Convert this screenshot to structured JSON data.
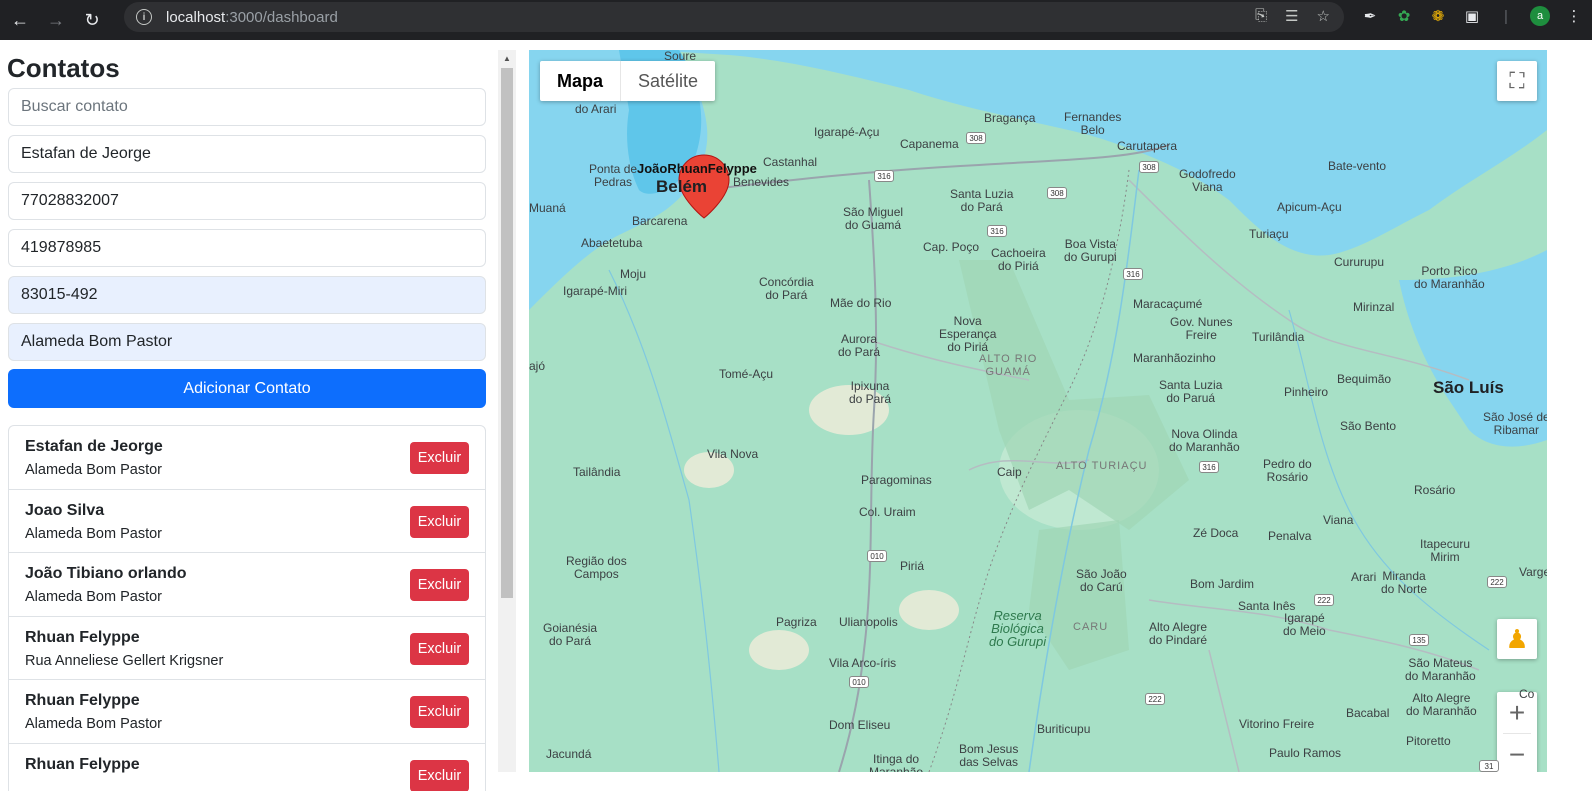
{
  "browser": {
    "url_host": "localhost",
    "url_path": ":3000/dashboard",
    "avatar_letter": "a"
  },
  "sidebar": {
    "title": "Contatos",
    "search_placeholder": "Buscar contato",
    "fields": {
      "name": "Estafan de Jeorge",
      "cpf": "77028832007",
      "phone": "419878985",
      "cep": "83015-492",
      "address": "Alameda Bom Pastor"
    },
    "add_button": "Adicionar Contato",
    "delete_label": "Excluir",
    "contacts": [
      {
        "name": "Estafan de Jeorge",
        "address": "Alameda Bom Pastor"
      },
      {
        "name": "Joao Silva",
        "address": "Alameda Bom Pastor"
      },
      {
        "name": "João Tibiano orlando",
        "address": "Alameda Bom Pastor"
      },
      {
        "name": "Rhuan Felyppe",
        "address": "Rua Anneliese Gellert Krigsner"
      },
      {
        "name": "Rhuan Felyppe",
        "address": "Alameda Bom Pastor"
      },
      {
        "name": "Rhuan Felyppe",
        "address": ""
      }
    ]
  },
  "map": {
    "type_map": "Mapa",
    "type_satellite": "Satélite",
    "marker_label": "JoãoRhuanFelyppe",
    "labels": {
      "soure": "Soure",
      "do_arari": "do Arari",
      "igarape_acu": "Igarapé-Açu",
      "braganca": "Bragança",
      "fernandes_belo": "Fernandes\nBelo",
      "capanema": "Capanema",
      "carutapera": "Carutapera",
      "ponta_de_pedras": "Ponta de\nPedras",
      "castanhal": "Castanhal",
      "benevides": "Benevides",
      "belem": "Belém",
      "bate_vento": "Bate-vento",
      "godofredo_viana": "Godofredo\nViana",
      "muana": "Muaná",
      "barcarena": "Barcarena",
      "santa_luzia_do_para": "Santa Luzia\ndo Pará",
      "sao_miguel_do_guama": "São Miguel\ndo Guamá",
      "apicum_acu": "Apicum-Açu",
      "abaetetuba": "Abaetetuba",
      "cap_poco": "Cap. Poço",
      "cachoeira_do_piria": "Cachoeira\ndo Piriá",
      "boa_vista_do_gurupi": "Boa Vista\ndo Gurupi",
      "turiacu": "Turiaçu",
      "moju": "Moju",
      "cururupu": "Cururupu",
      "igarape_miri": "Igarapé-Miri",
      "concordia_do_para": "Concórdia\ndo Pará",
      "porto_rico_do_maranhao": "Porto Rico\ndo Maranhão",
      "mae_do_rio": "Mãe do Rio",
      "maracacume": "Maracaçumé",
      "mirinzal": "Mirinzal",
      "nova_esperanca_do_piria": "Nova\nEsperança\ndo Piriá",
      "gov_nunes_freire": "Gov. Nunes\nFreire",
      "turilandia": "Turilândia",
      "aurora_do_para": "Aurora\ndo Pará",
      "alto_rio_guama": "ALTO RIO\nGUAMÁ",
      "maranhaozinho": "Maranhãozinho",
      "tome_acu": "Tomé-Açu",
      "bequimao": "Bequimão",
      "ipixuna_do_para": "Ipixuna\ndo Pará",
      "santa_luzia_do_parua": "Santa Luzia\ndo Paruá",
      "pinheiro": "Pinheiro",
      "sao_luis": "São Luís",
      "sao_jose_de_ribamar": "São José de\nRibamar",
      "sao_bento": "São Bento",
      "nova_olinda_do_maranhao": "Nova Olinda\ndo Maranhão",
      "vila_nova": "Vila Nova",
      "alto_turiacu": "ALTO TURIAÇU",
      "tailandia": "Tailândia",
      "caip": "Caip",
      "pedro_do_rosario": "Pedro do\nRosário",
      "paragominas": "Paragominas",
      "rosario": "Rosário",
      "col_uraim": "Col. Uraim",
      "ze_doca": "Zé Doca",
      "viana": "Viana",
      "penalva": "Penalva",
      "itapecuru_mirim": "Itapecuru\nMirim",
      "regiao_dos_campos": "Região dos\nCampos",
      "piria": "Piriá",
      "sao_joao_do_caru": "São João\ndo Carú",
      "bom_jardim": "Bom Jardim",
      "arari": "Arari",
      "miranda_do_norte": "Miranda\ndo Norte",
      "santa_ines": "Santa Inês",
      "igarape_do_meio": "Igarapé\ndo Meio",
      "goianesia_do_para": "Goianésia\ndo Pará",
      "pagriza": "Pagriza",
      "ulianopolis": "Ulianopolis",
      "reserva_biologica_do_gurupi": "Reserva\nBiológica\ndo Gurupi",
      "caru": "CARU",
      "alto_alegre_do_pindare": "Alto Alegre\ndo Pindaré",
      "vila_arco_iris": "Vila Arco-íris",
      "sao_mateus_do_maranhao": "São Mateus\ndo Maranhão",
      "alto_alegre_do_maranhao": "Alto Alegre\ndo Maranhão",
      "bacabal": "Bacabal",
      "dom_eliseu": "Dom Eliseu",
      "buriticupu": "Buriticupu",
      "vitorino_freire": "Vitorino Freire",
      "pitoretto": "Pitoretto",
      "jacunda": "Jacundá",
      "itinga_do_maranhao": "Itinga do\nMaranhão",
      "bom_jesus_das_selvas": "Bom Jesus\ndas Selvas",
      "paulo_ramos": "Paulo Ramos",
      "tajo": "ajó",
      "varge": "Varge",
      "co": "Co"
    },
    "highways": {
      "h308a": "308",
      "h308b": "308",
      "h308c": "308",
      "h316a": "316",
      "h316b": "316",
      "h316c": "316",
      "h316d": "316",
      "h010a": "010",
      "h010b": "010",
      "h222a": "222",
      "h222b": "222",
      "h222c": "222",
      "h135": "135",
      "h31": "31"
    }
  }
}
